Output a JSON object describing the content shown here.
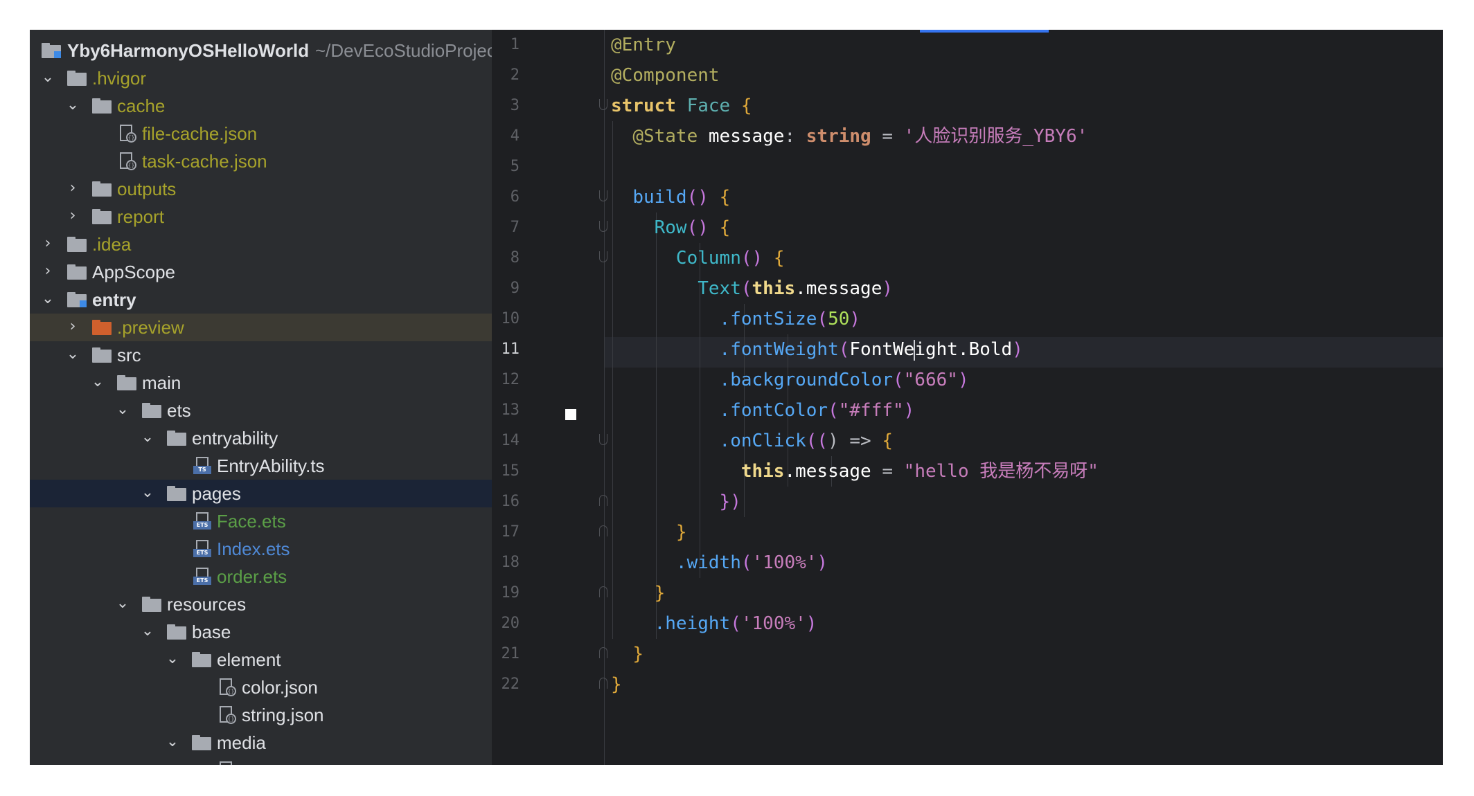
{
  "project_tree": {
    "root": {
      "name": "Yby6HarmonyOSHelloWorld",
      "path": "~/DevEcoStudioProjec"
    },
    "items": [
      {
        "label": ".hvigor",
        "icon": "folder-icon"
      },
      {
        "label": "cache",
        "icon": "folder-icon"
      },
      {
        "label": "file-cache.json",
        "icon": "json-file-icon"
      },
      {
        "label": "task-cache.json",
        "icon": "json-file-icon"
      },
      {
        "label": "outputs",
        "icon": "folder-icon"
      },
      {
        "label": "report",
        "icon": "folder-icon"
      },
      {
        "label": ".idea",
        "icon": "folder-icon"
      },
      {
        "label": "AppScope",
        "icon": "folder-icon"
      },
      {
        "label": "entry",
        "icon": "module-folder-icon"
      },
      {
        "label": ".preview",
        "icon": "folder-icon"
      },
      {
        "label": "src",
        "icon": "folder-icon"
      },
      {
        "label": "main",
        "icon": "folder-icon"
      },
      {
        "label": "ets",
        "icon": "folder-icon"
      },
      {
        "label": "entryability",
        "icon": "folder-icon"
      },
      {
        "label": "EntryAbility.ts",
        "icon": "ts-file-icon",
        "icon_tag": "TS"
      },
      {
        "label": "pages",
        "icon": "folder-icon"
      },
      {
        "label": "Face.ets",
        "icon": "ets-file-icon",
        "icon_tag": "ETS"
      },
      {
        "label": "Index.ets",
        "icon": "ets-file-icon",
        "icon_tag": "ETS"
      },
      {
        "label": "order.ets",
        "icon": "ets-file-icon",
        "icon_tag": "ETS"
      },
      {
        "label": "resources",
        "icon": "folder-icon"
      },
      {
        "label": "base",
        "icon": "folder-icon"
      },
      {
        "label": "element",
        "icon": "folder-icon"
      },
      {
        "label": "color.json",
        "icon": "json-file-icon"
      },
      {
        "label": "string.json",
        "icon": "json-file-icon"
      },
      {
        "label": "media",
        "icon": "folder-icon"
      }
    ]
  },
  "editor": {
    "current_line": 11,
    "line_numbers": [
      "1",
      "2",
      "3",
      "4",
      "5",
      "6",
      "7",
      "8",
      "9",
      "10",
      "11",
      "12",
      "13",
      "14",
      "15",
      "16",
      "17",
      "18",
      "19",
      "20",
      "21",
      "22"
    ],
    "lines": [
      [
        [
          "@Entry",
          "t-ann"
        ]
      ],
      [
        [
          "@Component",
          "t-ann"
        ]
      ],
      [
        [
          "struct",
          "t-kw2"
        ],
        [
          " ",
          "t-default"
        ],
        [
          "Face",
          "t-cls"
        ],
        [
          " ",
          "t-default"
        ],
        [
          "{",
          "t-brace"
        ]
      ],
      [
        [
          "  ",
          "t-default"
        ],
        [
          "@State",
          "t-ann"
        ],
        [
          " ",
          "t-default"
        ],
        [
          "message",
          "t-white"
        ],
        [
          ": ",
          "t-default"
        ],
        [
          "string",
          "t-kw"
        ],
        [
          " = ",
          "t-default"
        ],
        [
          "'人脸识别服务_YBY6'",
          "t-str"
        ]
      ],
      [],
      [
        [
          "  ",
          "t-default"
        ],
        [
          "build",
          "t-fn"
        ],
        [
          "()",
          "t-paren"
        ],
        [
          " ",
          "t-default"
        ],
        [
          "{",
          "t-brace"
        ]
      ],
      [
        [
          "    ",
          "t-default"
        ],
        [
          "Row",
          "t-fn2"
        ],
        [
          "()",
          "t-paren"
        ],
        [
          " ",
          "t-default"
        ],
        [
          "{",
          "t-brace"
        ]
      ],
      [
        [
          "      ",
          "t-default"
        ],
        [
          "Column",
          "t-fn2"
        ],
        [
          "()",
          "t-paren"
        ],
        [
          " ",
          "t-default"
        ],
        [
          "{",
          "t-brace"
        ]
      ],
      [
        [
          "        ",
          "t-default"
        ],
        [
          "Text",
          "t-fn2"
        ],
        [
          "(",
          "t-paren"
        ],
        [
          "this",
          "t-strong"
        ],
        [
          ".message",
          "t-white"
        ],
        [
          ")",
          "t-paren"
        ]
      ],
      [
        [
          "          ",
          "t-default"
        ],
        [
          ".fontSize",
          "t-fn"
        ],
        [
          "(",
          "t-paren"
        ],
        [
          "50",
          "t-num2"
        ],
        [
          ")",
          "t-paren"
        ]
      ],
      [
        [
          "          ",
          "t-default"
        ],
        [
          ".fontWeight",
          "t-fn"
        ],
        [
          "(",
          "t-paren"
        ],
        [
          "FontWe",
          "t-white"
        ],
        [
          "|caret|",
          ""
        ],
        [
          "ight.Bold",
          "t-white"
        ],
        [
          ")",
          "t-paren"
        ]
      ],
      [
        [
          "          ",
          "t-default"
        ],
        [
          ".backgroundColor",
          "t-fn"
        ],
        [
          "(",
          "t-paren"
        ],
        [
          "\"666\"",
          "t-str"
        ],
        [
          ")",
          "t-paren"
        ]
      ],
      [
        [
          "          ",
          "t-default"
        ],
        [
          ".fontColor",
          "t-fn"
        ],
        [
          "(",
          "t-paren"
        ],
        [
          "\"#fff\"",
          "t-str"
        ],
        [
          ")",
          "t-paren"
        ]
      ],
      [
        [
          "          ",
          "t-default"
        ],
        [
          ".onClick",
          "t-fn"
        ],
        [
          "((",
          "t-paren"
        ],
        [
          ") => ",
          "t-default"
        ],
        [
          "{",
          "t-brace"
        ]
      ],
      [
        [
          "            ",
          "t-default"
        ],
        [
          "this",
          "t-strong"
        ],
        [
          ".message",
          "t-white"
        ],
        [
          " = ",
          "t-default"
        ],
        [
          "\"hello 我是杨不易呀\"",
          "t-str"
        ]
      ],
      [
        [
          "          ",
          "t-default"
        ],
        [
          "})",
          "t-paren"
        ]
      ],
      [
        [
          "      ",
          "t-default"
        ],
        [
          "}",
          "t-brace"
        ]
      ],
      [
        [
          "      ",
          "t-default"
        ],
        [
          ".width",
          "t-fn"
        ],
        [
          "(",
          "t-paren"
        ],
        [
          "'100%'",
          "t-str"
        ],
        [
          ")",
          "t-paren"
        ]
      ],
      [
        [
          "    ",
          "t-default"
        ],
        [
          "}",
          "t-brace"
        ]
      ],
      [
        [
          "    ",
          "t-default"
        ],
        [
          ".height",
          "t-fn"
        ],
        [
          "(",
          "t-paren"
        ],
        [
          "'100%'",
          "t-str"
        ],
        [
          ")",
          "t-paren"
        ]
      ],
      [
        [
          "  ",
          "t-default"
        ],
        [
          "}",
          "t-brace"
        ]
      ],
      [
        [
          "}",
          "t-brace"
        ]
      ]
    ]
  }
}
